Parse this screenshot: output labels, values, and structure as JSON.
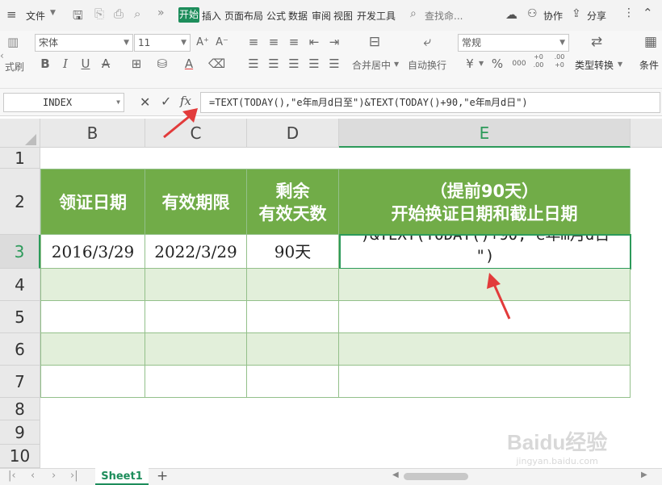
{
  "menubar": {
    "file_label": "文件",
    "tabs": [
      "开始",
      "插入",
      "页面布局",
      "公式",
      "数据",
      "审阅",
      "视图",
      "开发工具"
    ],
    "search_placeholder": "查找命...",
    "collab_label": "协作",
    "share_label": "分享"
  },
  "ribbon": {
    "font_name": "宋体",
    "font_size": "11",
    "number_format": "常规",
    "merge_label": "合并居中",
    "wrap_label": "自动换行",
    "convert_label": "类型转换",
    "cond_label": "条件",
    "left_cut_label": "式刷",
    "font_buttons": [
      "B",
      "I",
      "U"
    ],
    "currency_symbol": "¥",
    "percent_symbol": "%",
    "thousands_label": "000",
    "dec_inc_label": "+0 .00",
    "dec_dec_label": ".00 +0"
  },
  "formula_bar": {
    "name_box": "INDEX",
    "fx_label": "fx",
    "formula": "=TEXT(TODAY(),\"e年m月d日至\")&TEXT(TODAY()+90,\"e年m月d日\")"
  },
  "sheet": {
    "columns": [
      "B",
      "C",
      "D",
      "E"
    ],
    "rows": [
      "1",
      "2",
      "3",
      "4",
      "5",
      "6",
      "7",
      "8",
      "9",
      "10"
    ],
    "header": {
      "b": "领证日期",
      "c": "有效期限",
      "d_line1": "剩余",
      "d_line2": "有效天数",
      "e_line1": "（提前90天）",
      "e_line2": "开始换证日期和截止日期"
    },
    "row3": {
      "b": "2016/3/29",
      "c": "2022/3/29",
      "d": "90天",
      "e_line1": ")&TEXT(TODAY()+90,\"e年m月d日",
      "e_line2": "\")"
    }
  },
  "tabs": {
    "sheet_name": "Sheet1",
    "add_label": "+"
  },
  "watermark": {
    "line1": "Baidu经验",
    "line2": "jingyan.baidu.com"
  },
  "colors": {
    "header_fill": "#71ac48",
    "stripe_fill": "#e2efda",
    "active_tab": "#1d8d5b",
    "arrow": "#e23b3b"
  }
}
